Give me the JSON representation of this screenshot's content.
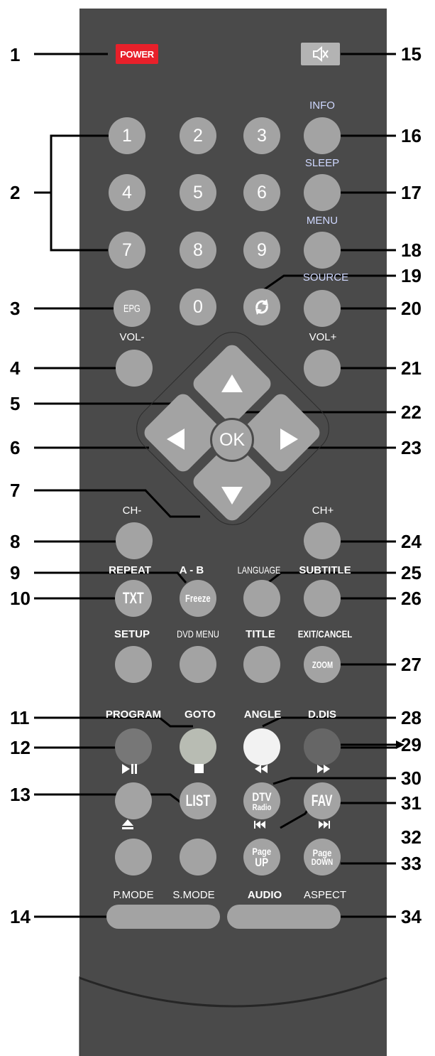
{
  "callouts": {
    "left": [
      "1",
      "2",
      "3",
      "4",
      "5",
      "6",
      "7",
      "8",
      "9",
      "10",
      "11",
      "12",
      "13",
      "14"
    ],
    "right": [
      "15",
      "16",
      "17",
      "18",
      "19",
      "20",
      "21",
      "22",
      "23",
      "24",
      "25",
      "26",
      "27",
      "28",
      "29",
      "30",
      "31",
      "32",
      "33",
      "34"
    ]
  },
  "power": {
    "label": "POWER",
    "color": "#e8202a"
  },
  "numbers": [
    "1",
    "2",
    "3",
    "4",
    "5",
    "6",
    "7",
    "8",
    "9",
    "0"
  ],
  "labels": {
    "info": "INFO",
    "sleep": "SLEEP",
    "menu": "MENU",
    "source": "SOURCE",
    "epg": "EPG",
    "vol_minus": "VOL-",
    "vol_plus": "VOL+",
    "ok": "OK",
    "ch_minus": "CH-",
    "ch_plus": "CH+",
    "repeat": "REPEAT",
    "a_b": "A - B",
    "language": "LANGUAGE",
    "subtitle": "SUBTITLE",
    "txt": "TXT",
    "freeze": "Freeze",
    "setup": "SETUP",
    "dvd_menu": "DVD MENU",
    "title": "TITLE",
    "exit_cancel": "EXIT/CANCEL",
    "zoom": "ZOOM",
    "program": "PROGRAM",
    "goto": "GOTO",
    "angle": "ANGLE",
    "d_dis": "D.DIS",
    "list": "LIST",
    "dtv": "DTV",
    "radio": "Radio",
    "fav": "FAV",
    "page": "Page",
    "up": "UP",
    "down": "DOWN",
    "p_mode": "P.MODE",
    "s_mode": "S.MODE",
    "audio": "AUDIO",
    "aspect": "ASPECT"
  },
  "icons": {
    "mute": "mute-speaker-icon",
    "recall": "recall-arrows-icon",
    "play_pause": "play-pause-icon",
    "stop": "stop-icon",
    "rewind": "rewind-icon",
    "fast_forward": "fast-forward-icon",
    "eject": "eject-icon",
    "prev": "skip-previous-icon",
    "next": "skip-next-icon"
  },
  "colors": {
    "body": "#4a4a4a",
    "button": "#a3a3a3",
    "program_button": "#777777",
    "angle_button": "#f2f2f2",
    "ddis_button": "#666666",
    "goto_button": "#b8bcb3"
  }
}
